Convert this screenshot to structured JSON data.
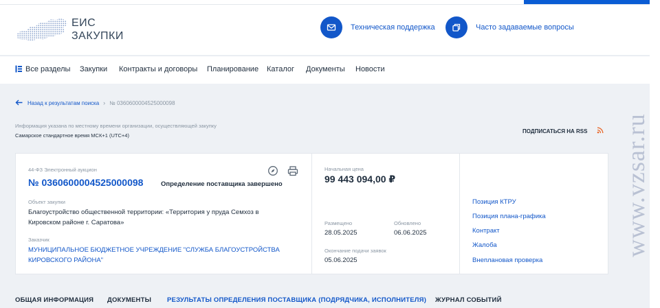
{
  "header": {
    "logo_line1": "ЕИС",
    "logo_line2": "ЗАКУПКИ",
    "support_label": "Техническая поддержка",
    "faq_label": "Часто задаваемые вопросы",
    "support_icon": "mail-icon",
    "faq_icon": "copy-icon"
  },
  "nav": {
    "items": [
      "Все разделы",
      "Закупки",
      "Контракты и договоры",
      "Планирование",
      "Каталог",
      "Документы",
      "Новости"
    ]
  },
  "breadcrumb": {
    "back_label": "Назад к результатам поиска",
    "separator": "›",
    "current": "№ 0360600004525000098"
  },
  "timezone": {
    "note": "Информация указана по местному времени организации, осуществляющей закупку",
    "value": "Самарское стандартное время МСК+1 (UTC+4)"
  },
  "rss": {
    "label": "ПОДПИСАТЬСЯ НА RSS"
  },
  "card": {
    "law": "44-ФЗ Электронный аукцион",
    "reg_number": "№ 0360600004525000098",
    "status": "Определение поставщика завершено",
    "object_label": "Объект закупки",
    "object_text": "Благоустройство общественной территории: «Территория у пруда Семхоз в Кировском районе г. Саратова»",
    "customer_label": "Заказчик",
    "customer_text": "МУНИЦИПАЛЬНОЕ БЮДЖЕТНОЕ УЧРЕЖДЕНИЕ \"СЛУЖБА БЛАГОУСТРОЙСТВА КИРОВСКОГО РАЙОНА\"",
    "price_label": "Начальная цена",
    "price": "99 443 094,00 ₽",
    "posted_label": "Размещено",
    "posted": "28.05.2025",
    "updated_label": "Обновлено",
    "updated": "06.06.2025",
    "deadline_label": "Окончание подачи заявок",
    "deadline": "05.06.2025"
  },
  "side_links": [
    "Позиция КТРУ",
    "Позиция плана-графика",
    "Контракт",
    "Жалоба",
    "Внеплановая проверка"
  ],
  "tabs": [
    "ОБЩАЯ ИНФОРМАЦИЯ",
    "ДОКУМЕНТЫ",
    "РЕЗУЛЬТАТЫ ОПРЕДЕЛЕНИЯ ПОСТАВЩИКА (ПОДРЯДЧИКА, ИСПОЛНИТЕЛЯ)",
    "ЖУРНАЛ СОБЫТИЙ"
  ],
  "watermark": "www.vzsar.ru",
  "colors": {
    "accent": "#1257c9",
    "rss": "#e8692c",
    "text": "#1f2d3d",
    "muted": "#8a96a3"
  }
}
